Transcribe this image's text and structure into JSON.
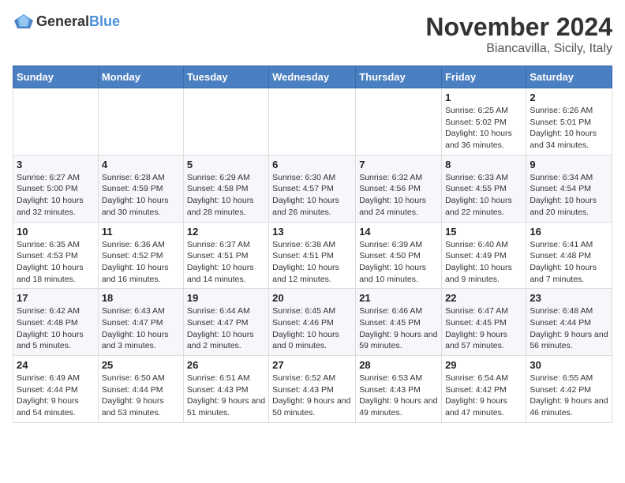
{
  "header": {
    "logo_general": "General",
    "logo_blue": "Blue",
    "month": "November 2024",
    "location": "Biancavilla, Sicily, Italy"
  },
  "days_of_week": [
    "Sunday",
    "Monday",
    "Tuesday",
    "Wednesday",
    "Thursday",
    "Friday",
    "Saturday"
  ],
  "weeks": [
    [
      {
        "day": "",
        "sunrise": "",
        "sunset": "",
        "daylight": ""
      },
      {
        "day": "",
        "sunrise": "",
        "sunset": "",
        "daylight": ""
      },
      {
        "day": "",
        "sunrise": "",
        "sunset": "",
        "daylight": ""
      },
      {
        "day": "",
        "sunrise": "",
        "sunset": "",
        "daylight": ""
      },
      {
        "day": "",
        "sunrise": "",
        "sunset": "",
        "daylight": ""
      },
      {
        "day": "1",
        "sunrise": "Sunrise: 6:25 AM",
        "sunset": "Sunset: 5:02 PM",
        "daylight": "Daylight: 10 hours and 36 minutes."
      },
      {
        "day": "2",
        "sunrise": "Sunrise: 6:26 AM",
        "sunset": "Sunset: 5:01 PM",
        "daylight": "Daylight: 10 hours and 34 minutes."
      }
    ],
    [
      {
        "day": "3",
        "sunrise": "Sunrise: 6:27 AM",
        "sunset": "Sunset: 5:00 PM",
        "daylight": "Daylight: 10 hours and 32 minutes."
      },
      {
        "day": "4",
        "sunrise": "Sunrise: 6:28 AM",
        "sunset": "Sunset: 4:59 PM",
        "daylight": "Daylight: 10 hours and 30 minutes."
      },
      {
        "day": "5",
        "sunrise": "Sunrise: 6:29 AM",
        "sunset": "Sunset: 4:58 PM",
        "daylight": "Daylight: 10 hours and 28 minutes."
      },
      {
        "day": "6",
        "sunrise": "Sunrise: 6:30 AM",
        "sunset": "Sunset: 4:57 PM",
        "daylight": "Daylight: 10 hours and 26 minutes."
      },
      {
        "day": "7",
        "sunrise": "Sunrise: 6:32 AM",
        "sunset": "Sunset: 4:56 PM",
        "daylight": "Daylight: 10 hours and 24 minutes."
      },
      {
        "day": "8",
        "sunrise": "Sunrise: 6:33 AM",
        "sunset": "Sunset: 4:55 PM",
        "daylight": "Daylight: 10 hours and 22 minutes."
      },
      {
        "day": "9",
        "sunrise": "Sunrise: 6:34 AM",
        "sunset": "Sunset: 4:54 PM",
        "daylight": "Daylight: 10 hours and 20 minutes."
      }
    ],
    [
      {
        "day": "10",
        "sunrise": "Sunrise: 6:35 AM",
        "sunset": "Sunset: 4:53 PM",
        "daylight": "Daylight: 10 hours and 18 minutes."
      },
      {
        "day": "11",
        "sunrise": "Sunrise: 6:36 AM",
        "sunset": "Sunset: 4:52 PM",
        "daylight": "Daylight: 10 hours and 16 minutes."
      },
      {
        "day": "12",
        "sunrise": "Sunrise: 6:37 AM",
        "sunset": "Sunset: 4:51 PM",
        "daylight": "Daylight: 10 hours and 14 minutes."
      },
      {
        "day": "13",
        "sunrise": "Sunrise: 6:38 AM",
        "sunset": "Sunset: 4:51 PM",
        "daylight": "Daylight: 10 hours and 12 minutes."
      },
      {
        "day": "14",
        "sunrise": "Sunrise: 6:39 AM",
        "sunset": "Sunset: 4:50 PM",
        "daylight": "Daylight: 10 hours and 10 minutes."
      },
      {
        "day": "15",
        "sunrise": "Sunrise: 6:40 AM",
        "sunset": "Sunset: 4:49 PM",
        "daylight": "Daylight: 10 hours and 9 minutes."
      },
      {
        "day": "16",
        "sunrise": "Sunrise: 6:41 AM",
        "sunset": "Sunset: 4:48 PM",
        "daylight": "Daylight: 10 hours and 7 minutes."
      }
    ],
    [
      {
        "day": "17",
        "sunrise": "Sunrise: 6:42 AM",
        "sunset": "Sunset: 4:48 PM",
        "daylight": "Daylight: 10 hours and 5 minutes."
      },
      {
        "day": "18",
        "sunrise": "Sunrise: 6:43 AM",
        "sunset": "Sunset: 4:47 PM",
        "daylight": "Daylight: 10 hours and 3 minutes."
      },
      {
        "day": "19",
        "sunrise": "Sunrise: 6:44 AM",
        "sunset": "Sunset: 4:47 PM",
        "daylight": "Daylight: 10 hours and 2 minutes."
      },
      {
        "day": "20",
        "sunrise": "Sunrise: 6:45 AM",
        "sunset": "Sunset: 4:46 PM",
        "daylight": "Daylight: 10 hours and 0 minutes."
      },
      {
        "day": "21",
        "sunrise": "Sunrise: 6:46 AM",
        "sunset": "Sunset: 4:45 PM",
        "daylight": "Daylight: 9 hours and 59 minutes."
      },
      {
        "day": "22",
        "sunrise": "Sunrise: 6:47 AM",
        "sunset": "Sunset: 4:45 PM",
        "daylight": "Daylight: 9 hours and 57 minutes."
      },
      {
        "day": "23",
        "sunrise": "Sunrise: 6:48 AM",
        "sunset": "Sunset: 4:44 PM",
        "daylight": "Daylight: 9 hours and 56 minutes."
      }
    ],
    [
      {
        "day": "24",
        "sunrise": "Sunrise: 6:49 AM",
        "sunset": "Sunset: 4:44 PM",
        "daylight": "Daylight: 9 hours and 54 minutes."
      },
      {
        "day": "25",
        "sunrise": "Sunrise: 6:50 AM",
        "sunset": "Sunset: 4:44 PM",
        "daylight": "Daylight: 9 hours and 53 minutes."
      },
      {
        "day": "26",
        "sunrise": "Sunrise: 6:51 AM",
        "sunset": "Sunset: 4:43 PM",
        "daylight": "Daylight: 9 hours and 51 minutes."
      },
      {
        "day": "27",
        "sunrise": "Sunrise: 6:52 AM",
        "sunset": "Sunset: 4:43 PM",
        "daylight": "Daylight: 9 hours and 50 minutes."
      },
      {
        "day": "28",
        "sunrise": "Sunrise: 6:53 AM",
        "sunset": "Sunset: 4:43 PM",
        "daylight": "Daylight: 9 hours and 49 minutes."
      },
      {
        "day": "29",
        "sunrise": "Sunrise: 6:54 AM",
        "sunset": "Sunset: 4:42 PM",
        "daylight": "Daylight: 9 hours and 47 minutes."
      },
      {
        "day": "30",
        "sunrise": "Sunrise: 6:55 AM",
        "sunset": "Sunset: 4:42 PM",
        "daylight": "Daylight: 9 hours and 46 minutes."
      }
    ]
  ]
}
